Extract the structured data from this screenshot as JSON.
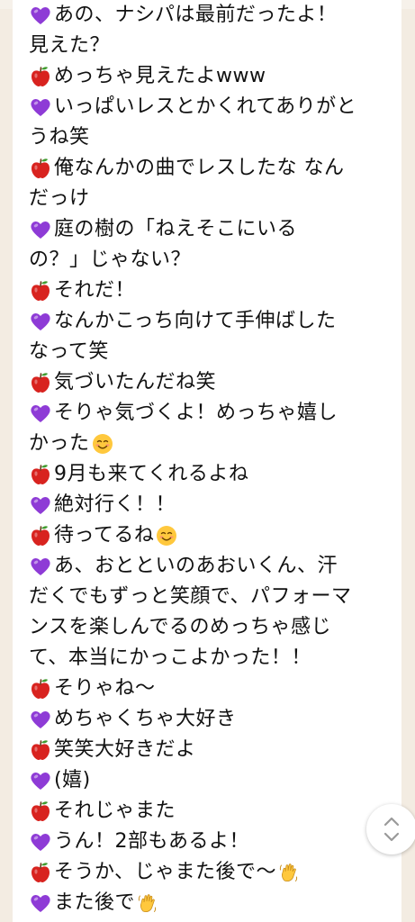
{
  "colors": {
    "heart": "#8e3bd6",
    "apple": "#d8231f",
    "page_bg": "#ffffff",
    "side_bg": "#f3ece2"
  },
  "icons": {
    "heart": "purple-heart-icon",
    "apple": "red-apple-icon",
    "smile": "smiling-face-icon",
    "wave": "waving-hand-icon",
    "scroll": "scroll-up-down-icon"
  },
  "lines": [
    {
      "mark": "heart",
      "text": "あの、ナシパは最前だったよ！",
      "emoji": ""
    },
    {
      "mark": "",
      "text": "見えた？",
      "emoji": ""
    },
    {
      "mark": "apple",
      "text": "めっちゃ見えたよwww",
      "emoji": ""
    },
    {
      "mark": "heart",
      "text": "いっぱいレスとかくれてありがと",
      "emoji": ""
    },
    {
      "mark": "",
      "text": "うね笑",
      "emoji": ""
    },
    {
      "mark": "apple",
      "text": "俺なんかの曲でレスしたな なん",
      "emoji": ""
    },
    {
      "mark": "",
      "text": "だっけ",
      "emoji": ""
    },
    {
      "mark": "heart",
      "text": "庭の樹の「ねえそこにいる",
      "emoji": ""
    },
    {
      "mark": "",
      "text": "の？」じゃない？",
      "emoji": ""
    },
    {
      "mark": "apple",
      "text": "それだ！",
      "emoji": ""
    },
    {
      "mark": "heart",
      "text": "なんかこっち向けて手伸ばした",
      "emoji": ""
    },
    {
      "mark": "",
      "text": "なって笑",
      "emoji": ""
    },
    {
      "mark": "apple",
      "text": "気づいたんだね笑",
      "emoji": ""
    },
    {
      "mark": "heart",
      "text": "そりゃ気づくよ！めっちゃ嬉し",
      "emoji": ""
    },
    {
      "mark": "",
      "text": "かった",
      "emoji": "smile"
    },
    {
      "mark": "apple",
      "text": "9月も来てくれるよね",
      "emoji": ""
    },
    {
      "mark": "heart",
      "text": "絶対行く！！",
      "emoji": ""
    },
    {
      "mark": "apple",
      "text": "待ってるね",
      "emoji": "smile"
    },
    {
      "mark": "heart",
      "text": "あ、おとといのあおいくん、汗",
      "emoji": ""
    },
    {
      "mark": "",
      "text": "だくでもずっと笑顔で、パフォーマ",
      "emoji": ""
    },
    {
      "mark": "",
      "text": "ンスを楽しんでるのめっちゃ感じ",
      "emoji": ""
    },
    {
      "mark": "",
      "text": "て、本当にかっこよかった！！",
      "emoji": ""
    },
    {
      "mark": "apple",
      "text": "そりゃね～",
      "emoji": ""
    },
    {
      "mark": "heart",
      "text": "めちゃくちゃ大好き",
      "emoji": ""
    },
    {
      "mark": "apple",
      "text": "笑笑大好きだよ",
      "emoji": ""
    },
    {
      "mark": "heart",
      "text": "(嬉)",
      "emoji": ""
    },
    {
      "mark": "apple",
      "text": "それじゃまた",
      "emoji": ""
    },
    {
      "mark": "heart",
      "text": "うん！2部もあるよ！",
      "emoji": ""
    },
    {
      "mark": "apple",
      "text": "そうか、じゃまた後で～",
      "emoji": "wave"
    },
    {
      "mark": "heart",
      "text": "また後で",
      "emoji": "wave"
    }
  ]
}
